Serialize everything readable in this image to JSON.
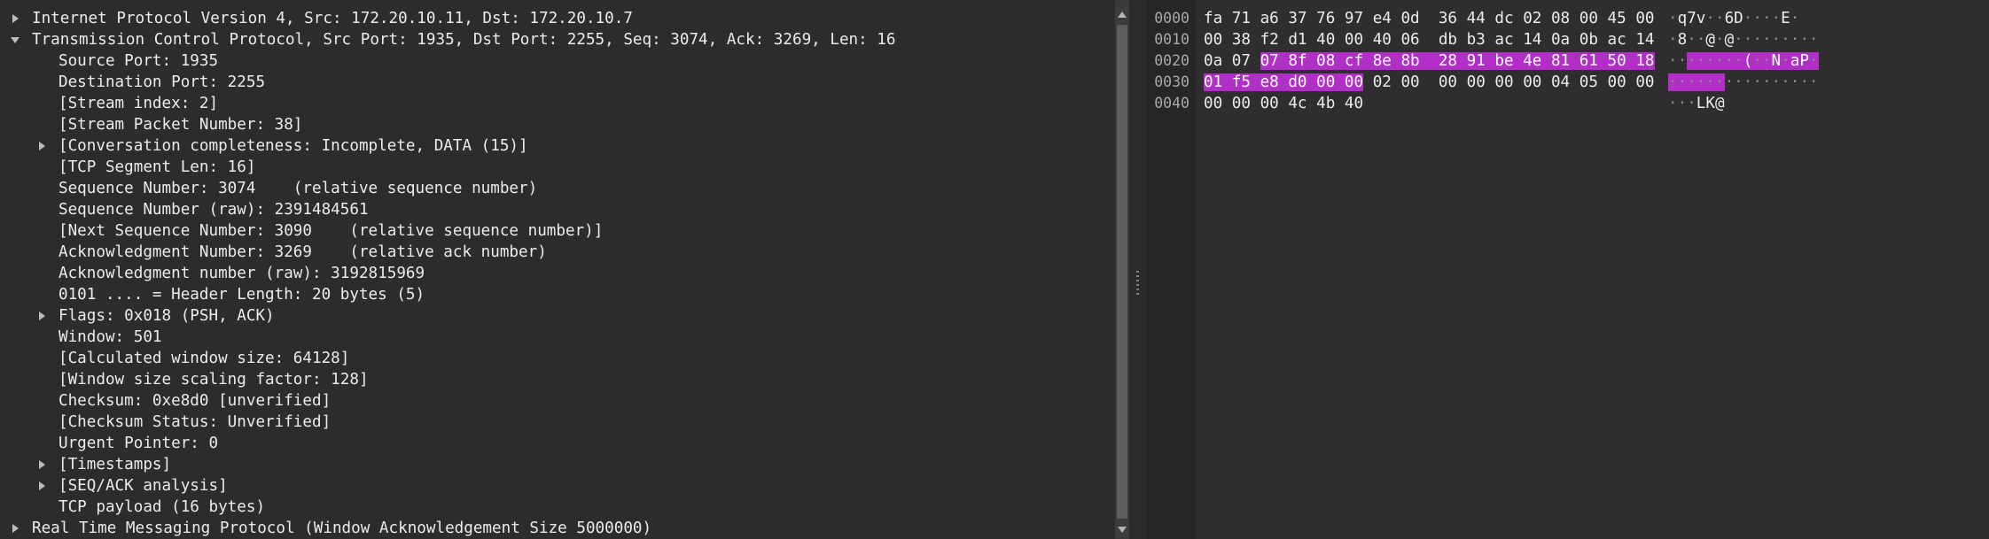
{
  "details": {
    "rows": [
      {
        "text": "Internet Protocol Version 4, Src: 172.20.10.11, Dst: 172.20.10.7",
        "indent": 0,
        "arrow": "collapsed"
      },
      {
        "text": "Transmission Control Protocol, Src Port: 1935, Dst Port: 2255, Seq: 3074, Ack: 3269, Len: 16",
        "indent": 0,
        "arrow": "expanded"
      },
      {
        "text": "Source Port: 1935",
        "indent": 1,
        "arrow": "none"
      },
      {
        "text": "Destination Port: 2255",
        "indent": 1,
        "arrow": "none"
      },
      {
        "text": "[Stream index: 2]",
        "indent": 1,
        "arrow": "none"
      },
      {
        "text": "[Stream Packet Number: 38]",
        "indent": 1,
        "arrow": "none"
      },
      {
        "text": "[Conversation completeness: Incomplete, DATA (15)]",
        "indent": 1,
        "arrow": "collapsed"
      },
      {
        "text": "[TCP Segment Len: 16]",
        "indent": 1,
        "arrow": "none"
      },
      {
        "text": "Sequence Number: 3074    (relative sequence number)",
        "indent": 1,
        "arrow": "none"
      },
      {
        "text": "Sequence Number (raw): 2391484561",
        "indent": 1,
        "arrow": "none"
      },
      {
        "text": "[Next Sequence Number: 3090    (relative sequence number)]",
        "indent": 1,
        "arrow": "none"
      },
      {
        "text": "Acknowledgment Number: 3269    (relative ack number)",
        "indent": 1,
        "arrow": "none"
      },
      {
        "text": "Acknowledgment number (raw): 3192815969",
        "indent": 1,
        "arrow": "none"
      },
      {
        "text": "0101 .... = Header Length: 20 bytes (5)",
        "indent": 1,
        "arrow": "none"
      },
      {
        "text": "Flags: 0x018 (PSH, ACK)",
        "indent": 1,
        "arrow": "collapsed"
      },
      {
        "text": "Window: 501",
        "indent": 1,
        "arrow": "none"
      },
      {
        "text": "[Calculated window size: 64128]",
        "indent": 1,
        "arrow": "none"
      },
      {
        "text": "[Window size scaling factor: 128]",
        "indent": 1,
        "arrow": "none"
      },
      {
        "text": "Checksum: 0xe8d0 [unverified]",
        "indent": 1,
        "arrow": "none"
      },
      {
        "text": "[Checksum Status: Unverified]",
        "indent": 1,
        "arrow": "none"
      },
      {
        "text": "Urgent Pointer: 0",
        "indent": 1,
        "arrow": "none"
      },
      {
        "text": "[Timestamps]",
        "indent": 1,
        "arrow": "collapsed"
      },
      {
        "text": "[SEQ/ACK analysis]",
        "indent": 1,
        "arrow": "collapsed"
      },
      {
        "text": "TCP payload (16 bytes)",
        "indent": 1,
        "arrow": "none"
      },
      {
        "text": "Real Time Messaging Protocol (Window Acknowledgement Size 5000000)",
        "indent": 0,
        "arrow": "collapsed"
      }
    ]
  },
  "bytes": {
    "lines": [
      {
        "offset": "0000",
        "hex": [
          "fa",
          "71",
          "a6",
          "37",
          "76",
          "97",
          "e4",
          "0d",
          "36",
          "44",
          "dc",
          "02",
          "08",
          "00",
          "45",
          "00"
        ],
        "ascii": "·q7v··6D····E·"
      },
      {
        "offset": "0010",
        "hex": [
          "00",
          "38",
          "f2",
          "d1",
          "40",
          "00",
          "40",
          "06",
          "db",
          "b3",
          "ac",
          "14",
          "0a",
          "0b",
          "ac",
          "14"
        ],
        "ascii": "·8··@·@·········"
      },
      {
        "offset": "0020",
        "hex": [
          "0a",
          "07",
          "07",
          "8f",
          "08",
          "cf",
          "8e",
          "8b",
          "28",
          "91",
          "be",
          "4e",
          "81",
          "61",
          "50",
          "18"
        ],
        "ascii": "········(··N·aP·"
      },
      {
        "offset": "0030",
        "hex": [
          "01",
          "f5",
          "e8",
          "d0",
          "00",
          "00",
          "02",
          "00",
          "00",
          "00",
          "00",
          "00",
          "04",
          "05",
          "00",
          "00"
        ],
        "ascii": "················"
      },
      {
        "offset": "0040",
        "hex": [
          "00",
          "00",
          "00",
          "4c",
          "4b",
          "40"
        ],
        "ascii": "···LK@"
      }
    ],
    "highlight_start": 34,
    "highlight_end": 53
  },
  "colors": {
    "highlight": "#b12fc6",
    "background": "#2b2b2b",
    "text": "#ececec"
  }
}
